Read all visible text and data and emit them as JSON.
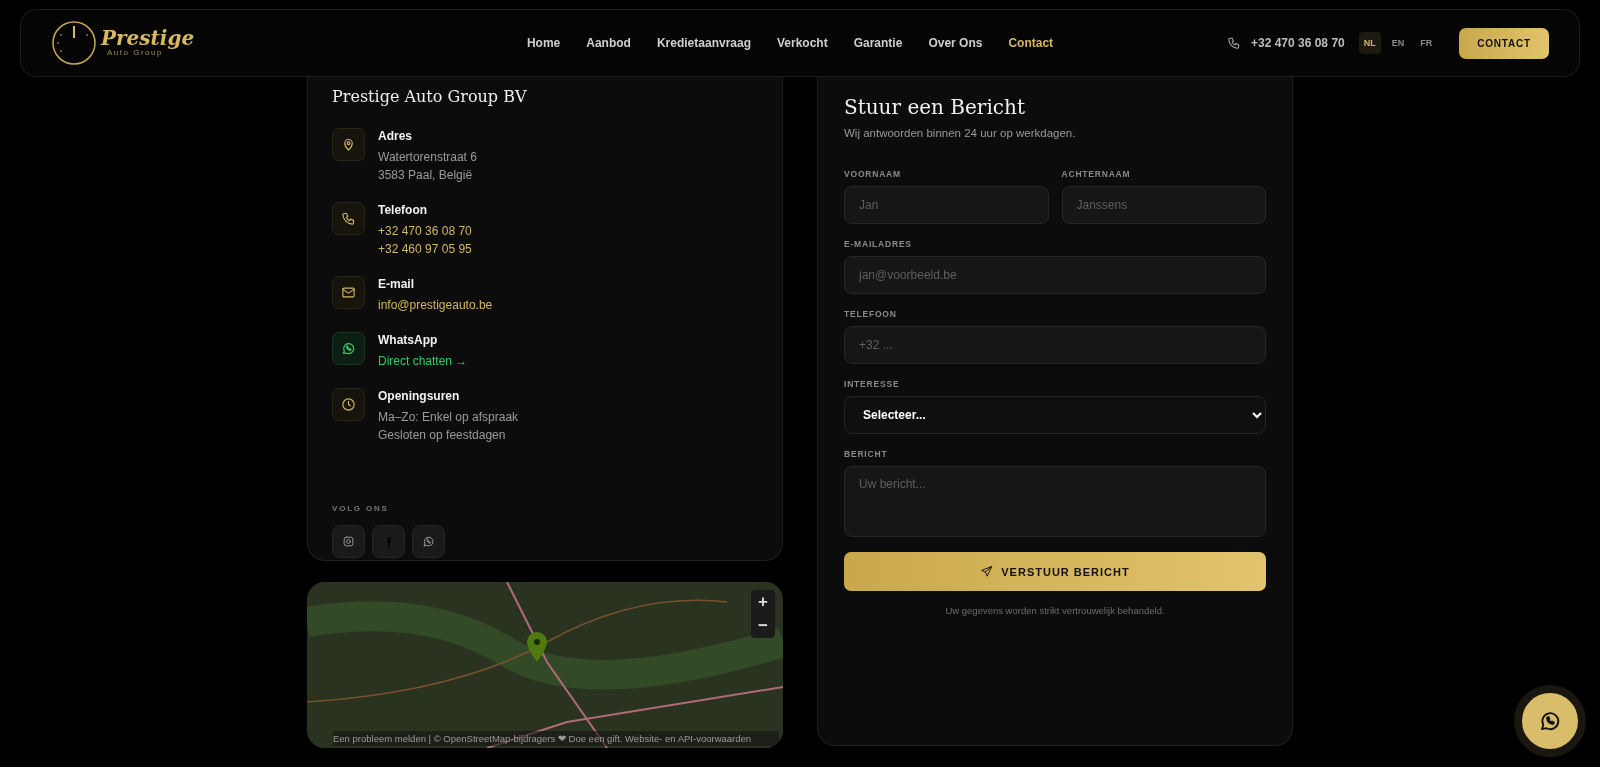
{
  "header": {
    "logo": {
      "name": "Prestige",
      "tagline": "Auto Group"
    },
    "nav": [
      {
        "label": "Home",
        "selected": false
      },
      {
        "label": "Aanbod",
        "selected": false
      },
      {
        "label": "Kredietaanvraag",
        "selected": false
      },
      {
        "label": "Verkocht",
        "selected": false
      },
      {
        "label": "Garantie",
        "selected": false
      },
      {
        "label": "Over Ons",
        "selected": false
      },
      {
        "label": "Contact",
        "selected": true
      }
    ],
    "phone": "+32 470 36 08 70",
    "languages": [
      {
        "label": "NL",
        "selected": true
      },
      {
        "label": "EN",
        "selected": false
      },
      {
        "label": "FR",
        "selected": false
      }
    ],
    "cta": "CONTACT"
  },
  "company": {
    "title": "Prestige Auto Group BV",
    "items": [
      {
        "kind": "address",
        "label": "Adres",
        "lines": [
          "Watertorenstraat 6",
          "3583 Paal, België"
        ]
      },
      {
        "kind": "phone",
        "label": "Telefoon",
        "lines": [
          "+32 470 36 08 70",
          "+32 460 97 05 95"
        ]
      },
      {
        "kind": "email",
        "label": "E-mail",
        "lines": [
          "info@prestigeauto.be"
        ]
      },
      {
        "kind": "whatsapp",
        "label": "WhatsApp",
        "lines": [
          "Direct chatten →"
        ]
      },
      {
        "kind": "hours",
        "label": "Openingsuren",
        "lines": [
          "Ma–Zo: Enkel op afspraak",
          "Gesloten op feestdagen"
        ]
      }
    ],
    "social_title": "VOLG ONS",
    "social": [
      {
        "kind": "instagram"
      },
      {
        "kind": "facebook"
      },
      {
        "kind": "whatsapp"
      }
    ]
  },
  "map": {
    "zoom_in": "+",
    "zoom_out": "−",
    "attribution": "Een probleem melden | © OpenStreetMap-bijdragers ❤ Doe een gift. Website- en API-voorwaarden"
  },
  "form": {
    "title": "Stuur een Bericht",
    "subtitle": "Wij antwoorden binnen 24 uur op werkdagen.",
    "rows": [
      [
        {
          "kind": "input",
          "label": "VOORNAAM",
          "placeholder": "Jan"
        },
        {
          "kind": "input",
          "label": "ACHTERNAAM",
          "placeholder": "Janssens"
        }
      ],
      [
        {
          "kind": "input",
          "label": "E-MAILADRES",
          "placeholder": "jan@voorbeeld.be"
        }
      ],
      [
        {
          "kind": "input",
          "label": "TELEFOON",
          "placeholder": "+32 ..."
        }
      ],
      [
        {
          "kind": "select",
          "label": "INTERESSE",
          "value": "Selecteer..."
        }
      ],
      [
        {
          "kind": "textarea",
          "label": "BERICHT",
          "placeholder": "Uw bericht..."
        }
      ]
    ],
    "submit": "VERSTUUR BERICHT",
    "note": "Uw gegevens worden strikt vertrouwelijk behandeld."
  }
}
